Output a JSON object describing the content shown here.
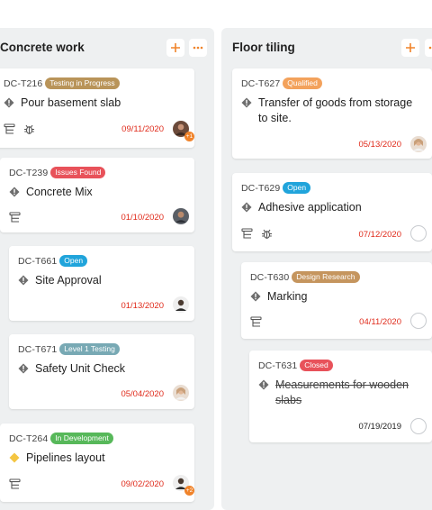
{
  "columns": [
    {
      "title": "Concrete work",
      "cards": [
        {
          "id": "DC-T216",
          "status": "Testing in Progress",
          "status_color": "#b99459",
          "title": "Pour basement slab",
          "priority": "gray",
          "date": "09/11/2020",
          "extra": "+1"
        },
        {
          "id": "DC-T239",
          "status": "Issues Found",
          "status_color": "#e8525a",
          "title": "Concrete Mix",
          "priority": "gray",
          "date": "01/10/2020"
        },
        {
          "id": "DC-T661",
          "status": "Open",
          "status_color": "#20a4db",
          "title": "Site Approval",
          "priority": "gray",
          "date": "01/13/2020"
        },
        {
          "id": "DC-T671",
          "status": "Level 1 Testing",
          "status_color": "#78a9b4",
          "title": "Safety Unit Check",
          "priority": "gray",
          "date": "05/04/2020"
        },
        {
          "id": "DC-T264",
          "status": "In Development",
          "status_color": "#57b85a",
          "title": "Pipelines layout",
          "priority": "yellow",
          "date": "09/02/2020",
          "extra": "+2"
        }
      ]
    },
    {
      "title": "Floor tiling",
      "cards": [
        {
          "id": "DC-T627",
          "status": "Qualified",
          "status_color": "#f3a25c",
          "title": "Transfer of goods from storage to site.",
          "priority": "gray",
          "date": "05/13/2020"
        },
        {
          "id": "DC-T629",
          "status": "Open",
          "status_color": "#20a4db",
          "title": "Adhesive application",
          "priority": "gray",
          "date": "07/12/2020"
        },
        {
          "id": "DC-T630",
          "status": "Design Research",
          "status_color": "#c5955e",
          "title": "Marking",
          "priority": "gray",
          "date": "04/11/2020"
        },
        {
          "id": "DC-T631",
          "status": "Closed",
          "status_color": "#e8525a",
          "title": "Measurements for wooden slabs",
          "priority": "gray",
          "date": "07/19/2019"
        }
      ]
    }
  ],
  "colors": {
    "accent": "#f0832a",
    "due_date": "#e02b1b",
    "column_bg": "#eef0f1"
  },
  "icons": {
    "add": "plus-icon",
    "more": "ellipsis-icon",
    "subtasks": "subtask-list-icon",
    "bug": "bug-icon",
    "priority": "diamond-priority-icon"
  }
}
